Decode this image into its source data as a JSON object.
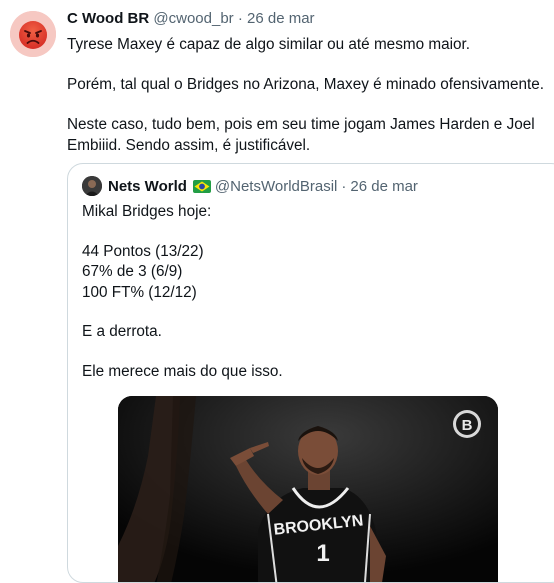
{
  "tweet": {
    "author_name": "C Wood BR",
    "author_handle": "@cwood_br",
    "separator": "·",
    "date": "26 de mar",
    "avatar_icon": "angry-face-emoji-icon",
    "paragraphs": [
      "Tyrese Maxey é capaz de algo similar ou até mesmo maior.",
      "Porém, tal qual o Bridges no Arizona, Maxey é minado ofensivamente.",
      "Neste caso, tudo bem, pois em seu time jogam James Harden e Joel Embiiid. Sendo assim, é justificável."
    ]
  },
  "quoted_tweet": {
    "author_name": "Nets World",
    "flag_icon": "brazil-flag-icon",
    "author_handle": "@NetsWorldBrasil",
    "separator": "·",
    "date": "26 de mar",
    "paragraphs": [
      "Mikal Bridges hoje:",
      "44 Pontos (13/22)\n67% de 3 (6/9)\n100 FT% (12/12)",
      "E a derrota.",
      "Ele merece mais do que isso."
    ],
    "media": {
      "description_icon": "basketball-player-photo",
      "jersey_text": "BROOKLYN",
      "jersey_number": "1",
      "logo_icon": "nets-logo-icon"
    }
  }
}
